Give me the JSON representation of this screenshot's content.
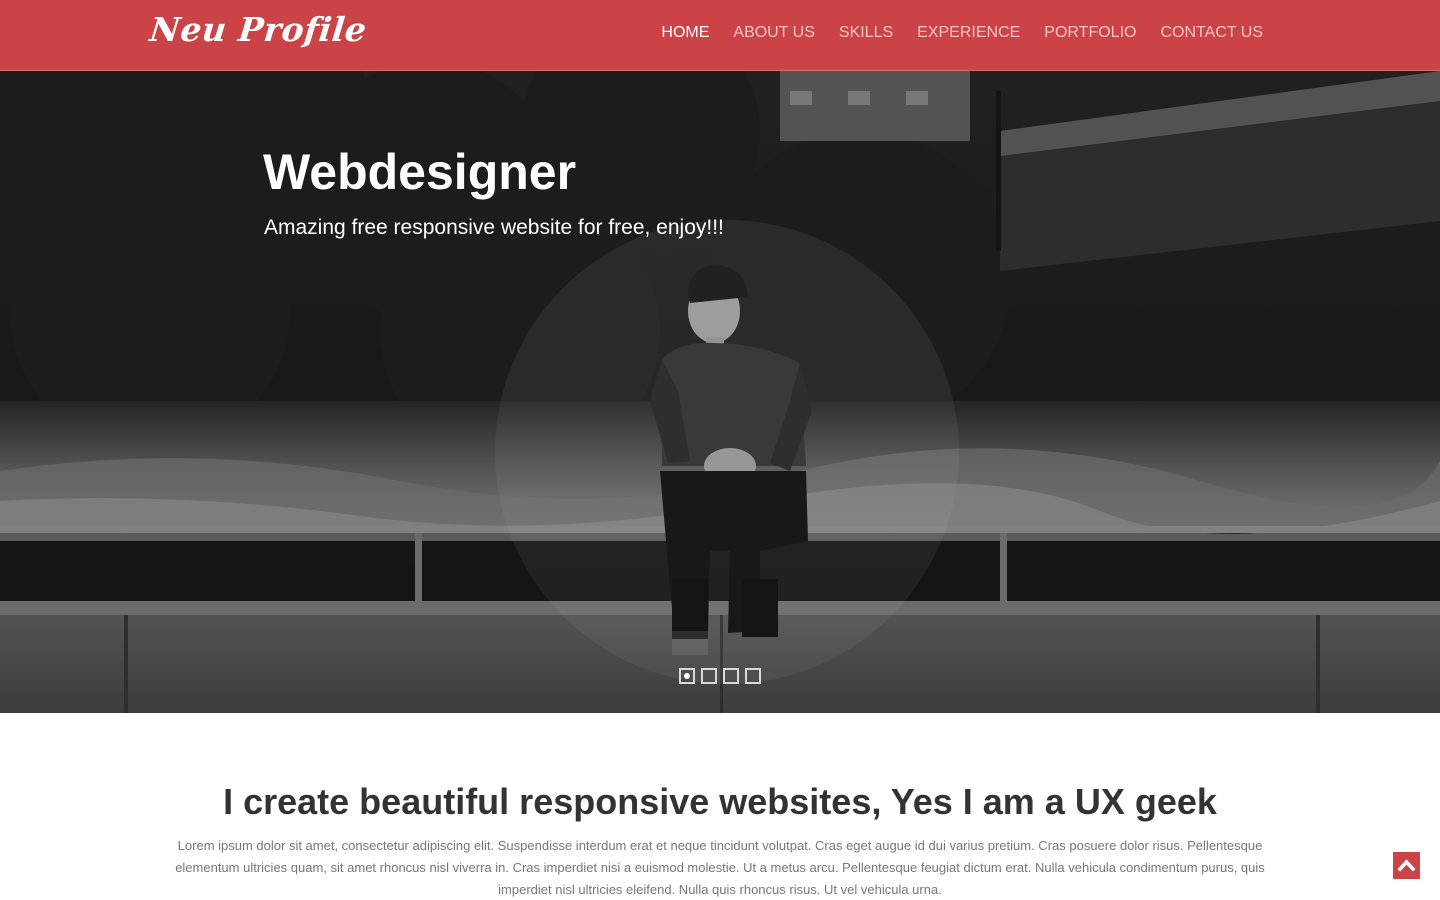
{
  "navbar": {
    "brand": "Neu Profile",
    "items": [
      {
        "label": "HOME",
        "active": true
      },
      {
        "label": "ABOUT US",
        "active": false
      },
      {
        "label": "SKILLS",
        "active": false
      },
      {
        "label": "EXPERIENCE",
        "active": false
      },
      {
        "label": "PORTFOLIO",
        "active": false
      },
      {
        "label": "CONTACT US",
        "active": false
      }
    ]
  },
  "hero": {
    "title": "Webdesigner",
    "subtitle": "Amazing free responsive website for free, enjoy!!!",
    "slides": 4,
    "active_slide": 1
  },
  "intro": {
    "title": "I create beautiful responsive websites, Yes I am a UX geek",
    "text": "Lorem ipsum dolor sit amet, consectetur adipiscing elit. Suspendisse interdum erat et neque tincidunt volutpat. Cras eget augue id dui varius pretium. Cras posuere dolor risus. Pellentesque elementum ultricies quam, sit amet rhoncus nisl viverra in. Cras imperdiet nisi a euismod molestie. Ut a metus arcu. Pellentesque feugiat dictum erat. Nulla vehicula condimentum purus, quis imperdiet nisl ultricies eleifend. Nulla quis rhoncus risus. Ut vel vehicula urna."
  },
  "colors": {
    "accent": "#cc4347",
    "nav_inactive": "#f2c4c5",
    "heading": "#333333",
    "body_text": "#777777"
  },
  "icons": {
    "back_to_top": "chevron-up-icon"
  }
}
